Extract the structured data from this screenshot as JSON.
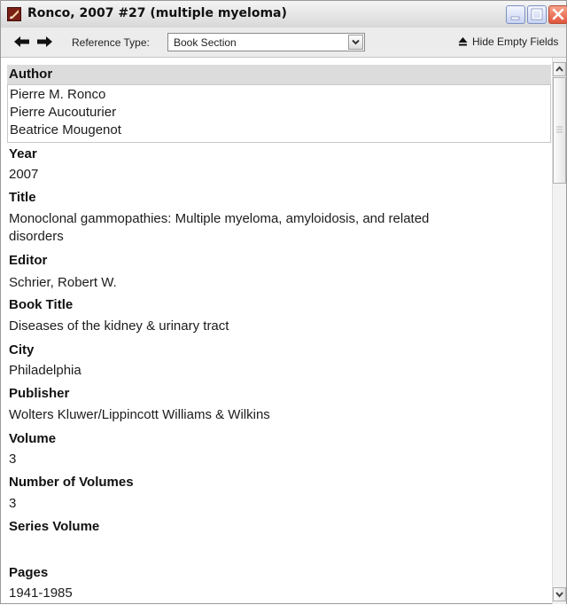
{
  "window": {
    "title": "Ronco, 2007 #27 (multiple myeloma)"
  },
  "toolbar": {
    "reference_type_label": "Reference Type:",
    "reference_type_value": "Book Section",
    "hide_empty_label": "Hide Empty Fields"
  },
  "fields": {
    "author": {
      "label": "Author",
      "values": [
        "Pierre M. Ronco",
        "Pierre Aucouturier",
        "Beatrice Mougenot"
      ]
    },
    "year": {
      "label": "Year",
      "value": "2007"
    },
    "title": {
      "label": "Title",
      "line1": "Monoclonal gammopathies: Multiple myeloma, amyloidosis, and related",
      "line2": "disorders"
    },
    "editor": {
      "label": "Editor",
      "value": "Schrier, Robert W."
    },
    "book_title": {
      "label": "Book Title",
      "value": "Diseases of the kidney & urinary tract"
    },
    "city": {
      "label": "City",
      "value": "Philadelphia"
    },
    "publisher": {
      "label": "Publisher",
      "value": "Wolters Kluwer/Lippincott Williams & Wilkins"
    },
    "volume": {
      "label": "Volume",
      "value": "3"
    },
    "number_of_volumes": {
      "label": "Number of Volumes",
      "value": "3"
    },
    "series_volume": {
      "label": "Series Volume",
      "value": ""
    },
    "pages": {
      "label": "Pages",
      "value": "1941-1985"
    }
  },
  "icons": {
    "app": "endnote-app-icon",
    "back": "arrow-left-icon",
    "forward": "arrow-right-icon",
    "dropdown": "chevron-down-icon",
    "hide_empty": "triangle-up-icon",
    "minimize": "minimize-icon",
    "maximize": "maximize-icon",
    "close": "close-icon"
  },
  "colors": {
    "close_button": "#e0553c",
    "title_button": "#c7d3f2",
    "author_band": "#dcdcdc"
  }
}
